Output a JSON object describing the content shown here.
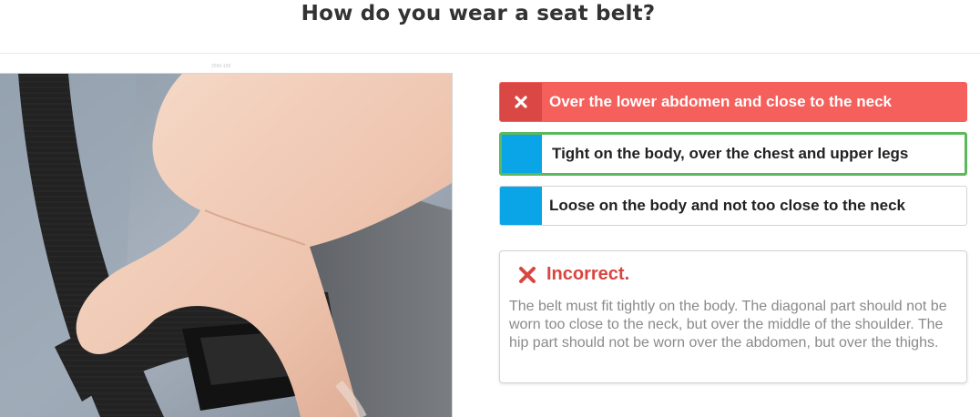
{
  "question": {
    "title": "How do you wear a seat belt?"
  },
  "image": {
    "credit": "2556-109",
    "icon": "photo-seat-belt-buckle"
  },
  "answers": [
    {
      "label": "Over the lower abdomen and close to the neck",
      "state": "selected-wrong",
      "color": "#f5605c",
      "icon": "close-icon"
    },
    {
      "label": "Tight on the body, over the chest and upper legs",
      "state": "correct",
      "color": "#5cb85c"
    },
    {
      "label": "Loose on the body and not too close to the neck",
      "state": "default",
      "color": "#0aa5e6"
    }
  ],
  "feedback": {
    "status": "Incorrect.",
    "icon": "close-icon",
    "color": "#d9453f",
    "explanation": "The belt must fit tightly on the body. The diagonal part should not be worn too close to the neck, but over the middle of the shoulder. The hip part should not be worn over the abdomen, but over the thighs."
  }
}
